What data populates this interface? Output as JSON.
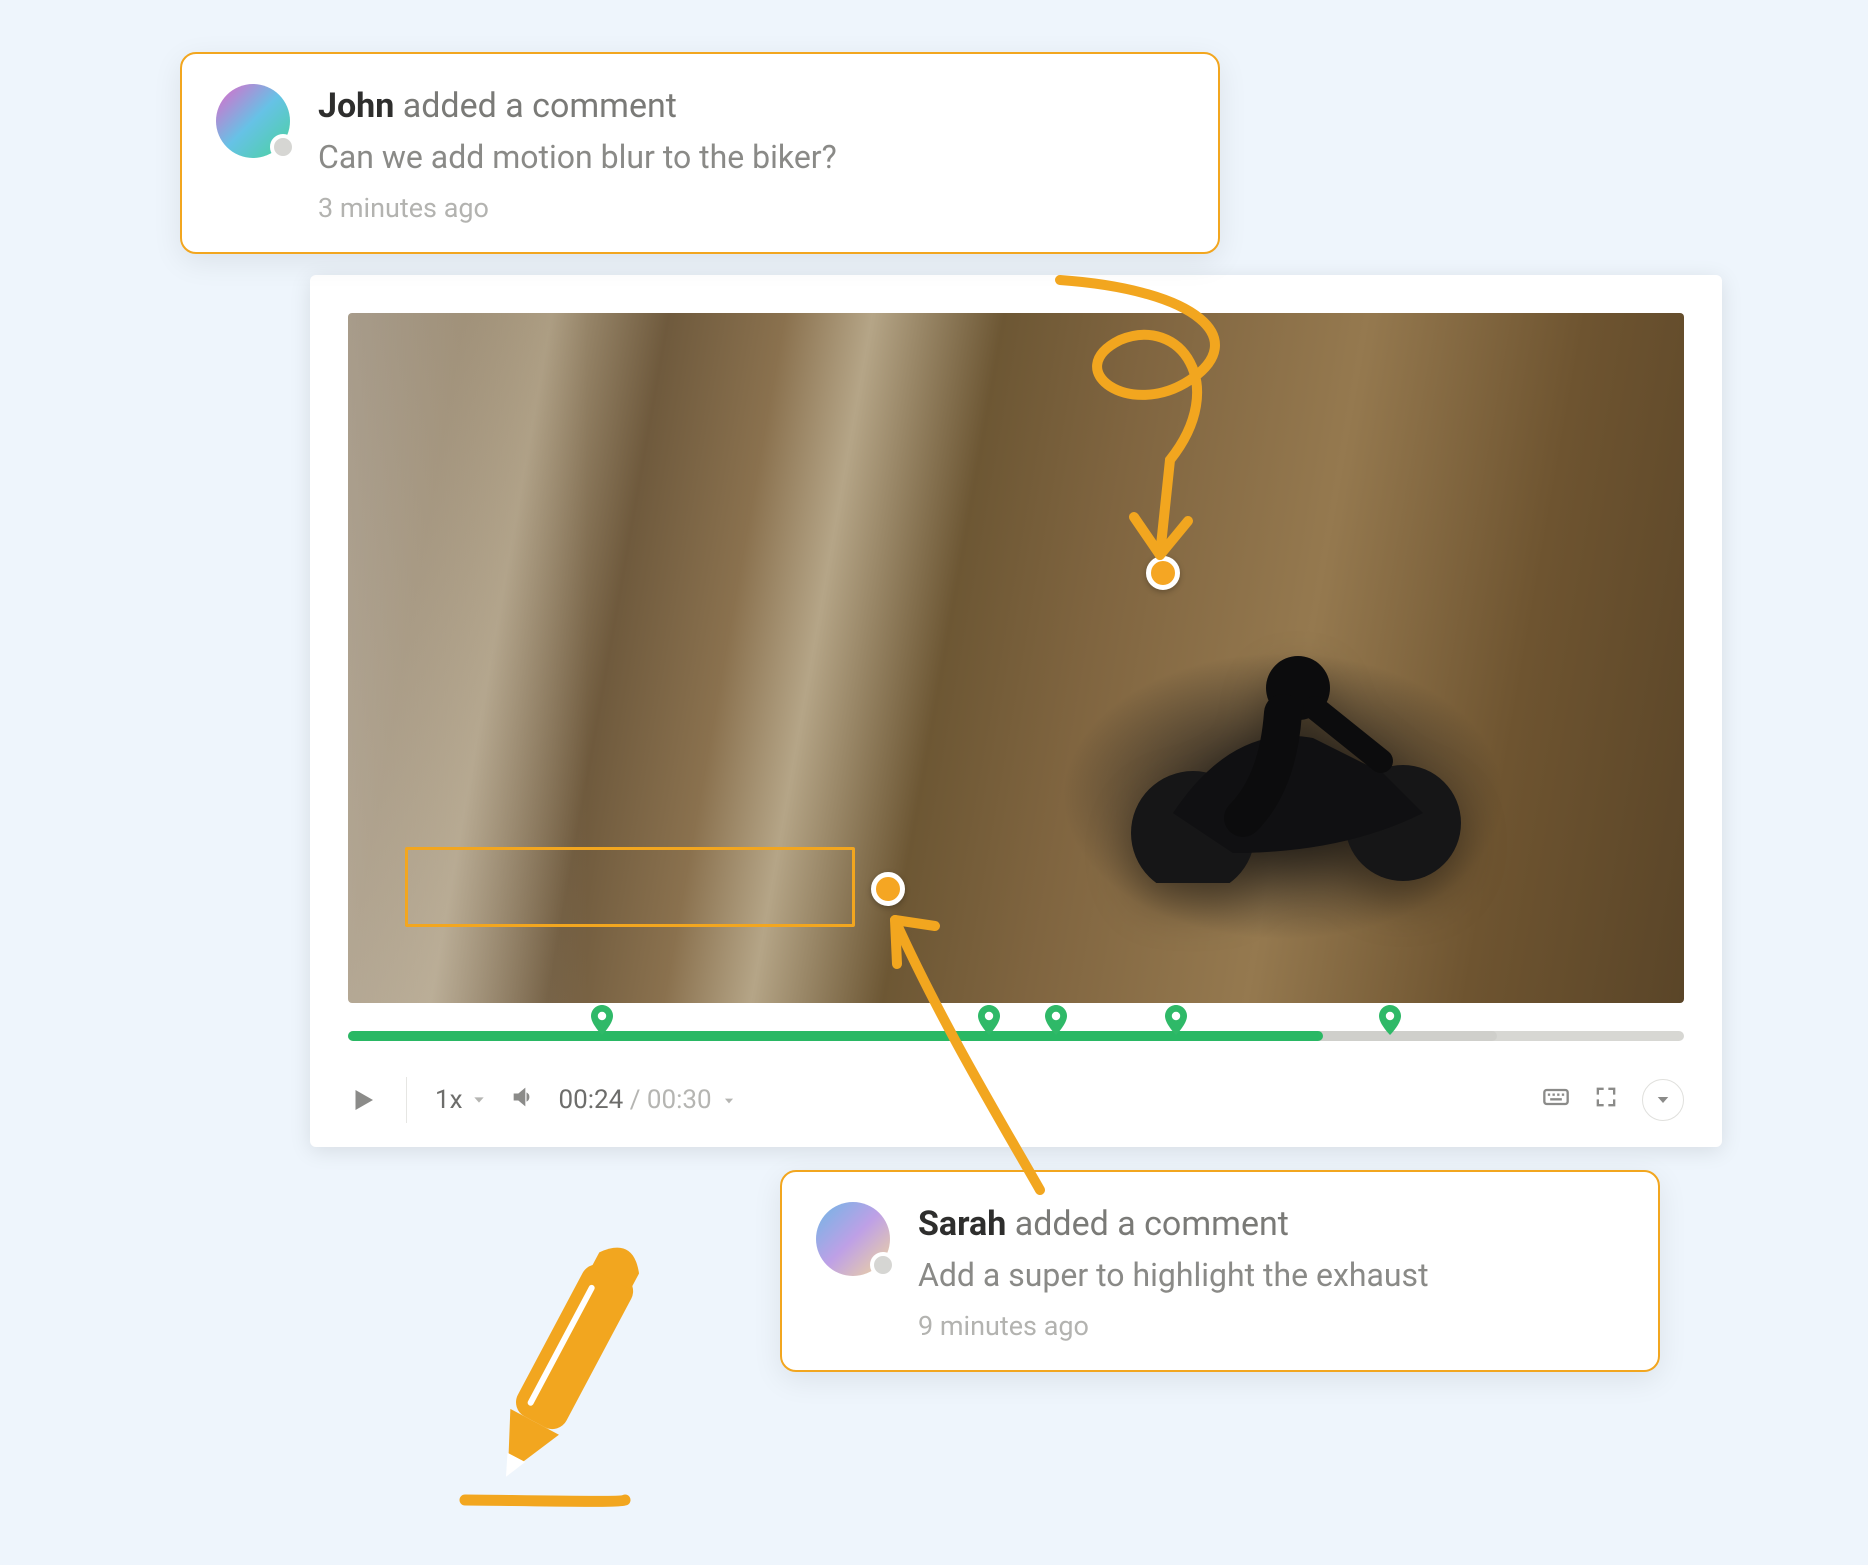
{
  "player": {
    "speed_label": "1x",
    "current_time": "00:24",
    "separator": " / ",
    "duration": "00:30",
    "progress_played_pct": 73,
    "progress_buffered_pct": 86,
    "comment_pin_positions_pct": [
      19,
      48,
      53,
      62,
      78
    ]
  },
  "annotations": {
    "dot_top": {
      "desc": "marker-on-biker"
    },
    "dot_bottom": {
      "desc": "marker-near-exhaust"
    },
    "rect": {
      "desc": "selection-box-road"
    }
  },
  "comments": [
    {
      "author": "John",
      "action": "added a comment",
      "text": "Can we add motion blur to the biker?",
      "time": "3 minutes ago"
    },
    {
      "author": "Sarah",
      "action": "added a comment",
      "text": "Add a super to highlight the exhaust",
      "time": "9 minutes ago"
    }
  ],
  "colors": {
    "accent_orange": "#f2a61f",
    "timeline_green": "#29b864",
    "page_bg": "#eef5fc"
  }
}
